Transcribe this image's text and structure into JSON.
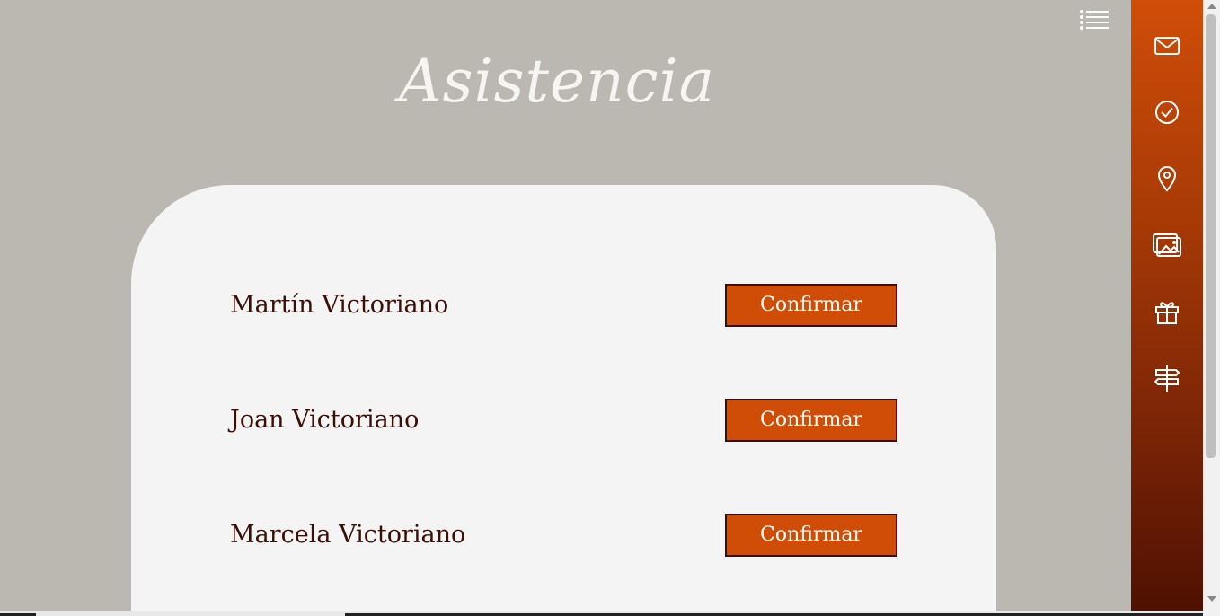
{
  "header": {
    "title": "Asistencia",
    "menu_icon": "list-icon"
  },
  "guests": [
    {
      "name": "Martín Victoriano",
      "button_label": "Confirmar"
    },
    {
      "name": "Joan Victoriano",
      "button_label": "Confirmar"
    },
    {
      "name": "Marcela Victoriano",
      "button_label": "Confirmar"
    }
  ],
  "sidebar": {
    "icons": [
      "mail-icon",
      "check-circle-icon",
      "location-pin-icon",
      "gallery-icon",
      "gift-icon",
      "signpost-icon"
    ]
  },
  "colors": {
    "background": "#bbb8b1",
    "card": "#f4f4f4",
    "accent": "#d04d08",
    "text": "#3a0f06",
    "sidebar_top": "#d04d08",
    "sidebar_bottom": "#4e1002"
  }
}
